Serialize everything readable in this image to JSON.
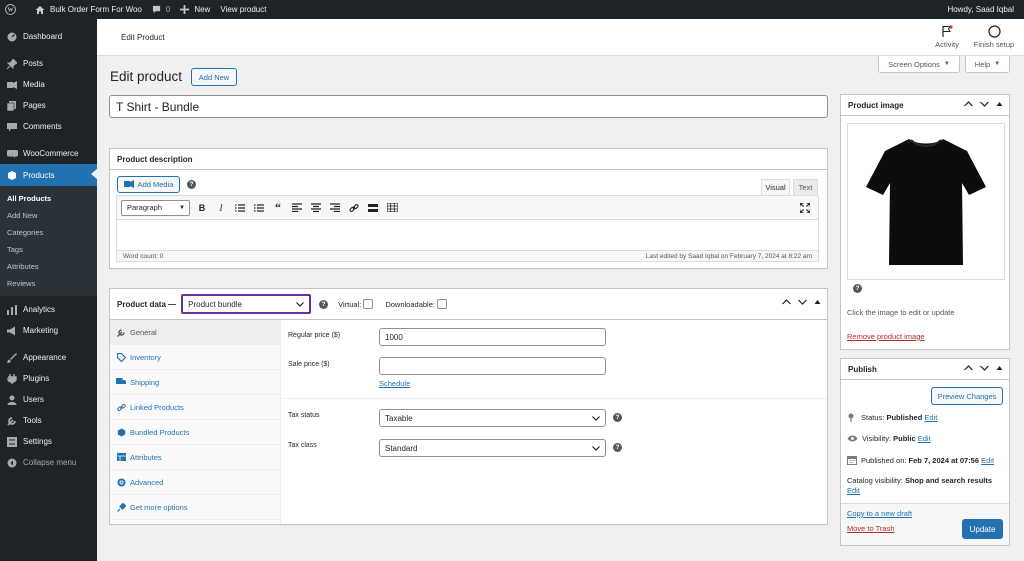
{
  "admin_bar": {
    "site_name": "Bulk Order Form For Woo",
    "comments_count": "0",
    "new_label": "New",
    "view_label": "View product",
    "howdy": "Howdy, Saad Iqbal"
  },
  "sidebar": {
    "items": [
      {
        "label": "Dashboard",
        "icon": "dashboard-icon"
      },
      {
        "label": "Posts",
        "icon": "pin-icon"
      },
      {
        "label": "Media",
        "icon": "media-icon"
      },
      {
        "label": "Pages",
        "icon": "pages-icon"
      },
      {
        "label": "Comments",
        "icon": "comments-icon"
      },
      {
        "label": "WooCommerce",
        "icon": "woocommerce-icon"
      },
      {
        "label": "Products",
        "icon": "products-icon"
      },
      {
        "label": "Analytics",
        "icon": "analytics-icon"
      },
      {
        "label": "Marketing",
        "icon": "marketing-icon"
      },
      {
        "label": "Appearance",
        "icon": "appearance-icon"
      },
      {
        "label": "Plugins",
        "icon": "plugins-icon"
      },
      {
        "label": "Users",
        "icon": "users-icon"
      },
      {
        "label": "Tools",
        "icon": "tools-icon"
      },
      {
        "label": "Settings",
        "icon": "settings-icon"
      },
      {
        "label": "Collapse menu",
        "icon": "collapse-icon"
      }
    ],
    "submenu": [
      "All Products",
      "Add New",
      "Categories",
      "Tags",
      "Attributes",
      "Reviews"
    ]
  },
  "wc_header": {
    "title": "Edit Product",
    "activity": "Activity",
    "finish_setup": "Finish setup"
  },
  "screen_options": "Screen Options",
  "help": "Help",
  "page": {
    "heading": "Edit product",
    "add_new": "Add New",
    "product_title": "T Shirt - Bundle"
  },
  "description": {
    "title": "Product description",
    "add_media": "Add Media",
    "tab_visual": "Visual",
    "tab_text": "Text",
    "format_select": "Paragraph",
    "word_count": "Word count: 0",
    "last_edited": "Last edited by Saad Iqbal on February 7, 2024 at 8:22 am"
  },
  "product_data": {
    "label": "Product data —",
    "type_selected": "Product bundle",
    "virtual_label": "Virtual:",
    "downloadable_label": "Downloadable:",
    "tabs": [
      "General",
      "Inventory",
      "Shipping",
      "Linked Products",
      "Bundled Products",
      "Attributes",
      "Advanced",
      "Get more options"
    ],
    "regular_price_label": "Regular price ($)",
    "regular_price_value": "1000",
    "sale_price_label": "Sale price ($)",
    "sale_price_value": "",
    "schedule": "Schedule",
    "tax_status_label": "Tax status",
    "tax_status_value": "Taxable",
    "tax_class_label": "Tax class",
    "tax_class_value": "Standard"
  },
  "product_image": {
    "title": "Product image",
    "hint": "Click the image to edit or update",
    "remove": "Remove product image"
  },
  "publish": {
    "title": "Publish",
    "preview": "Preview Changes",
    "status_label": "Status:",
    "status_value": "Published",
    "visibility_label": "Visibility:",
    "visibility_value": "Public",
    "published_label": "Published on:",
    "published_value": "Feb 7, 2024 at 07:56",
    "edit": "Edit",
    "catalog_label": "Catalog visibility:",
    "catalog_value": "Shop and search results",
    "copy_draft": "Copy to a new draft",
    "trash": "Move to Trash",
    "update": "Update"
  },
  "colors": {
    "admin_dark": "#1d2327",
    "accent": "#2271b1",
    "highlight_border": "#6b2fa0",
    "danger": "#b32d2e"
  }
}
